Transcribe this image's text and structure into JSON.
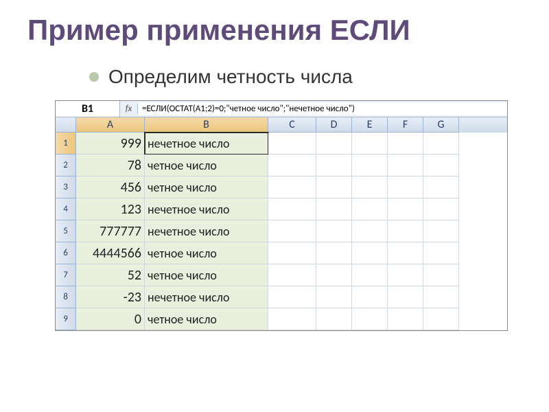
{
  "slide": {
    "title": "Пример применения ЕСЛИ",
    "subtitle": "Определим четность числа"
  },
  "excel": {
    "namebox": "B1",
    "fx": "fx",
    "formula": "=ЕСЛИ(ОСТАТ(A1;2)=0;\"четное число\";\"нечетное число\")",
    "columns": [
      "A",
      "B",
      "C",
      "D",
      "E",
      "F",
      "G"
    ],
    "rows": [
      {
        "n": "1",
        "a": "999",
        "b": "нечетное число"
      },
      {
        "n": "2",
        "a": "78",
        "b": "четное число"
      },
      {
        "n": "3",
        "a": "456",
        "b": "четное число"
      },
      {
        "n": "4",
        "a": "123",
        "b": "нечетное число"
      },
      {
        "n": "5",
        "a": "777777",
        "b": "нечетное число"
      },
      {
        "n": "6",
        "a": "4444566",
        "b": "четное число"
      },
      {
        "n": "7",
        "a": "52",
        "b": "четное число"
      },
      {
        "n": "8",
        "a": "-23",
        "b": "нечетное число"
      },
      {
        "n": "9",
        "a": "0",
        "b": "четное число"
      }
    ]
  }
}
